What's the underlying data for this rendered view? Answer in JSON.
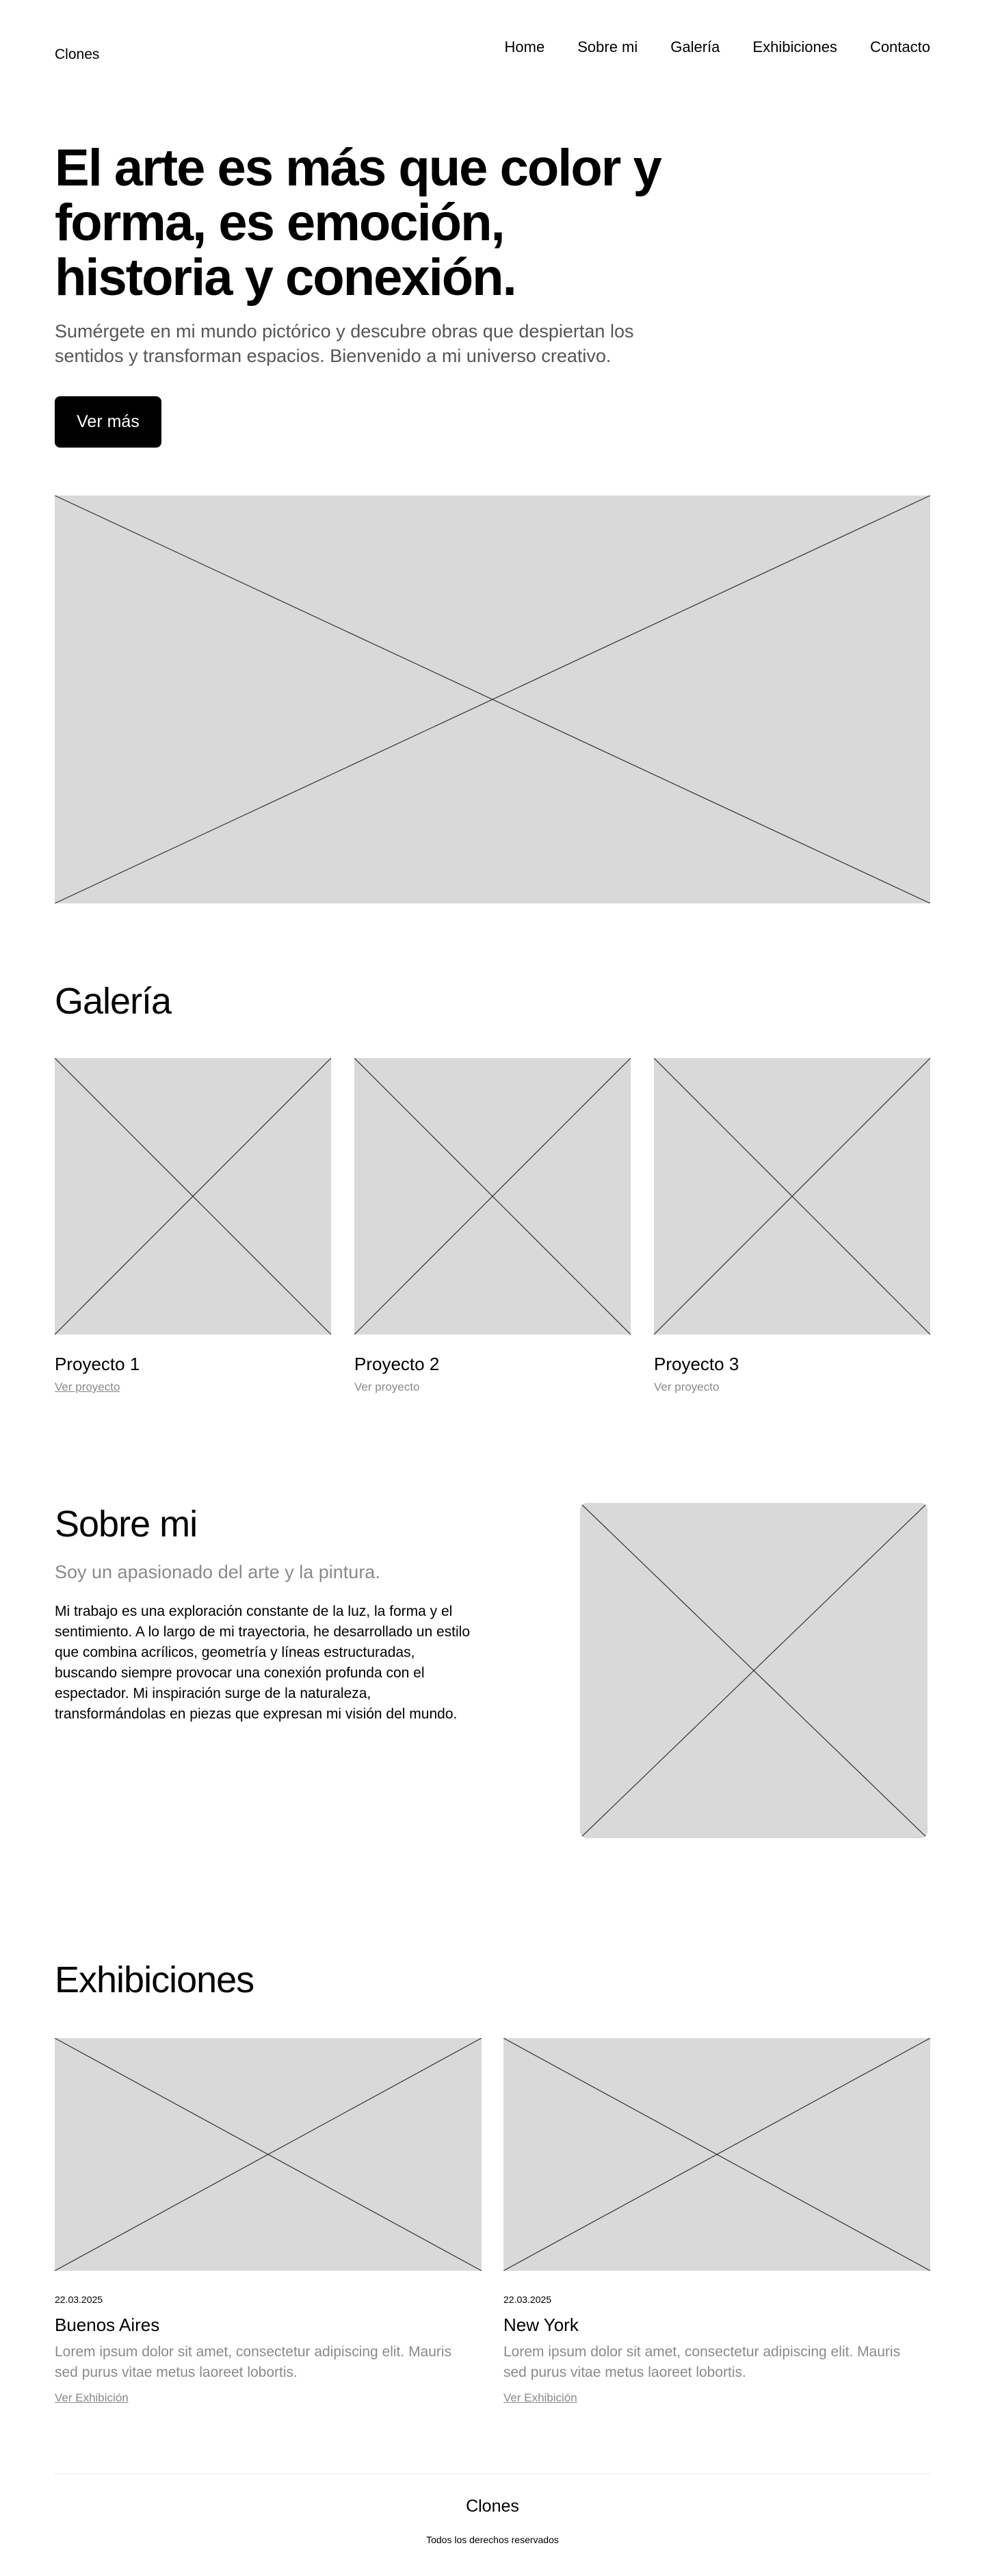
{
  "header": {
    "brand": "Clones",
    "nav": [
      "Home",
      "Sobre mi",
      "Galería",
      "Exhibiciones",
      "Contacto"
    ]
  },
  "hero": {
    "title": "El arte es más que color y forma, es emoción, historia y conexión.",
    "subtitle": "Sumérgete en mi mundo pictórico y descubre obras que despiertan los sentidos y transforman espacios. Bienvenido a mi universo creativo.",
    "cta_label": "Ver más"
  },
  "gallery": {
    "title": "Galería",
    "items": [
      {
        "title": "Proyecto 1",
        "link": "Ver proyecto"
      },
      {
        "title": "Proyecto 2",
        "link": "Ver proyecto"
      },
      {
        "title": "Proyecto 3",
        "link": "Ver proyecto"
      }
    ]
  },
  "about": {
    "title": "Sobre mi",
    "subtitle": "Soy un apasionado del arte y la pintura.",
    "body": "Mi trabajo es una exploración constante de la luz, la forma y el sentimiento. A lo largo de mi trayectoria, he desarrollado un estilo que combina acrílicos, geometría y líneas estructuradas, buscando siempre provocar una conexión profunda con el espectador. Mi inspiración surge de la naturaleza, transformándolas en piezas que expresan mi visión del mundo."
  },
  "exhibitions": {
    "title": "Exhibiciones",
    "items": [
      {
        "date": "22.03.2025",
        "city": "Buenos Aires",
        "description": "Lorem ipsum dolor sit amet, consectetur adipiscing elit. Mauris sed purus vitae metus laoreet lobortis.",
        "link": "Ver Exhibición"
      },
      {
        "date": "22.03.2025",
        "city": "New York",
        "description": "Lorem ipsum dolor sit amet, consectetur adipiscing elit. Mauris sed purus vitae metus laoreet lobortis.",
        "link": "Ver Exhibición"
      }
    ]
  },
  "footer": {
    "brand": "Clones",
    "copyright": "Todos los derechos reservados"
  },
  "colors": {
    "placeholder": "#d9d9d9",
    "primary_button": "#000000",
    "muted_text": "#8a8a8a"
  }
}
